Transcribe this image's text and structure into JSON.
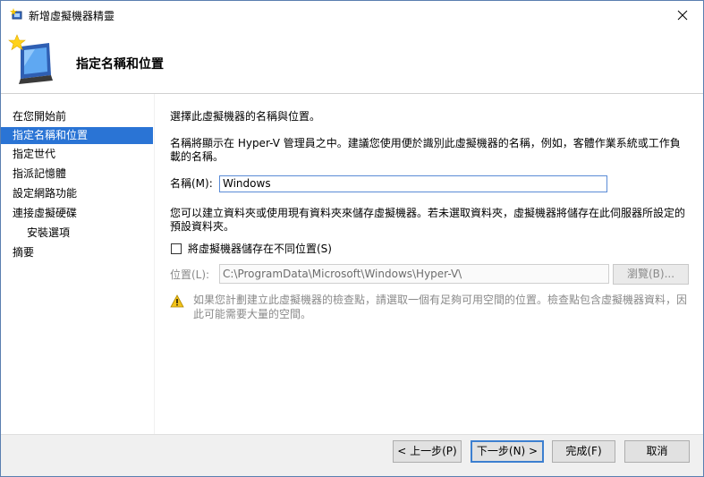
{
  "window": {
    "title": "新增虛擬機器精靈"
  },
  "header": {
    "title": "指定名稱和位置"
  },
  "sidebar": {
    "items": [
      {
        "label": "在您開始前",
        "selected": false
      },
      {
        "label": "指定名稱和位置",
        "selected": true
      },
      {
        "label": "指定世代",
        "selected": false
      },
      {
        "label": "指派記憶體",
        "selected": false
      },
      {
        "label": "設定網路功能",
        "selected": false
      },
      {
        "label": "連接虛擬硬碟",
        "selected": false
      },
      {
        "label": "安裝選項",
        "selected": false
      },
      {
        "label": "摘要",
        "selected": false
      }
    ]
  },
  "content": {
    "intro": "選擇此虛擬機器的名稱與位置。",
    "name_description_line1": "名稱將顯示在 Hyper-V 管理員之中。建議您使用便於識別此虛擬機器的名稱，例如，客體作業系統或工作負",
    "name_description_line2": "載的名稱。",
    "name_label": "名稱(M):",
    "name_value": "Windows",
    "folder_description_line1": "您可以建立資料夾或使用現有資料夾來儲存虛擬機器。若未選取資料夾，虛擬機器將儲存在此伺服器所設定的",
    "folder_description_line2": "預設資料夾。",
    "store_checkbox_label": "將虛擬機器儲存在不同位置(S)",
    "store_checked": false,
    "location_label": "位置(L):",
    "location_value": "C:\\ProgramData\\Microsoft\\Windows\\Hyper-V\\",
    "browse_label": "瀏覽(B)...",
    "warning_line1": "如果您計劃建立此虛擬機器的檢查點，請選取一個有足夠可用空間的位置。檢查點包含虛擬機器資料，因",
    "warning_line2": "此可能需要大量的空間。"
  },
  "footer": {
    "back_label": "< 上一步(P)",
    "next_label": "下一步(N) >",
    "finish_label": "完成(F)",
    "cancel_label": "取消"
  },
  "colors": {
    "selection": "#2a74d5",
    "input_border": "#5a8bd6",
    "disabled_text": "#8a8a8a"
  }
}
